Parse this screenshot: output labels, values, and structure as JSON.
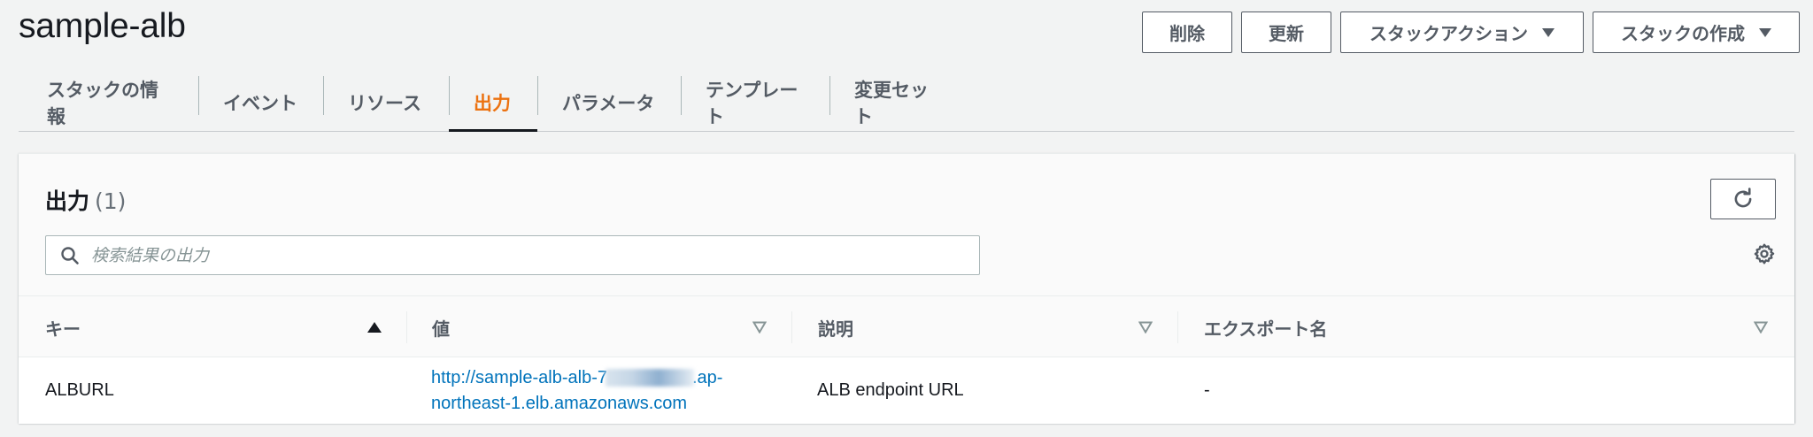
{
  "page": {
    "title": "sample-alb"
  },
  "actions": {
    "delete": "削除",
    "update": "更新",
    "stack_actions": "スタックアクション",
    "create_stack": "スタックの作成"
  },
  "tabs": [
    {
      "label": "スタックの情報",
      "active": false
    },
    {
      "label": "イベント",
      "active": false
    },
    {
      "label": "リソース",
      "active": false
    },
    {
      "label": "出力",
      "active": true
    },
    {
      "label": "パラメータ",
      "active": false
    },
    {
      "label": "テンプレート",
      "active": false
    },
    {
      "label": "変更セット",
      "active": false
    }
  ],
  "panel": {
    "title": "出力",
    "count": "(1)",
    "search_placeholder": "検索結果の出力"
  },
  "table": {
    "columns": [
      "キー",
      "値",
      "説明",
      "エクスポート名"
    ],
    "rows": [
      {
        "key": "ALBURL",
        "value_prefix": "http://sample-alb-alb-7",
        "value_suffix": ".ap-",
        "value_line2": "northeast-1.elb.amazonaws.com",
        "description": "ALB endpoint URL",
        "export_name": "-"
      }
    ]
  },
  "colors": {
    "accent": "#ec7211",
    "link": "#0073bb",
    "text": "#16191f",
    "muted": "#545b64"
  }
}
